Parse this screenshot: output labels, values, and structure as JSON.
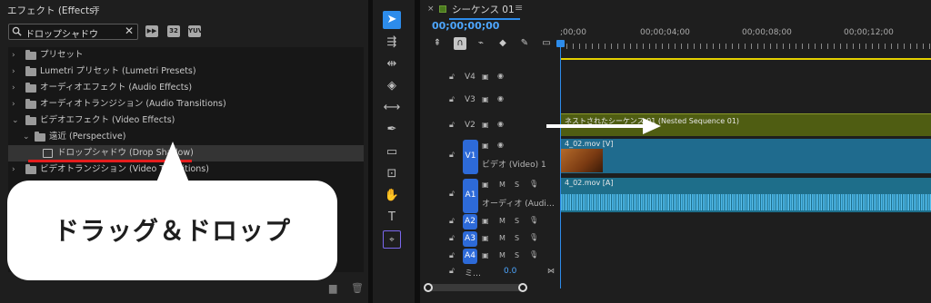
{
  "effects_panel": {
    "title": "エフェクト (Effects)",
    "menu": "≡",
    "search_value": "ドロップシャドウ",
    "clear": "✕",
    "filter_buttons": [
      "▶▶",
      "32",
      "YUV"
    ],
    "tree": [
      {
        "label": "プリセット",
        "arrow": "›",
        "indent": 0,
        "selected": false
      },
      {
        "label": "Lumetri プリセット (Lumetri Presets)",
        "arrow": "›",
        "indent": 0,
        "selected": false
      },
      {
        "label": "オーディオエフェクト (Audio Effects)",
        "arrow": "›",
        "indent": 0,
        "selected": false
      },
      {
        "label": "オーディオトランジション (Audio Transitions)",
        "arrow": "›",
        "indent": 0,
        "selected": false
      },
      {
        "label": "ビデオエフェクト (Video Effects)",
        "arrow": "⌄",
        "indent": 0,
        "selected": false
      },
      {
        "label": "遠近 (Perspective)",
        "arrow": "⌄",
        "indent": 1,
        "selected": false
      },
      {
        "label": "ドロップシャドウ (Drop Shadow)",
        "arrow": "",
        "indent": 2,
        "selected": true
      },
      {
        "label": "ビデオトランジション (Video Transitions)",
        "arrow": "›",
        "indent": 0,
        "selected": false
      }
    ],
    "bottom_icons": [
      "new-folder-icon",
      "trash-icon"
    ]
  },
  "callout": {
    "text": "ドラッグ＆ドロップ"
  },
  "tools": [
    "selection",
    "track-select-forward",
    "ripple-edit",
    "razor",
    "slip",
    "pen",
    "rectangle",
    "hand-move",
    "hand",
    "type",
    "generative-extend"
  ],
  "timeline": {
    "close": "×",
    "title": "シーケンス 01",
    "menu": "≡",
    "timecode": "00;00;00;00",
    "ruler_labels": [
      ";00;00",
      "00;00;04;00",
      "00;00;08;00",
      "00;00;12;00"
    ],
    "tracks": [
      {
        "name": "V4",
        "kind": "video",
        "lock": true
      },
      {
        "name": "V3",
        "kind": "video",
        "lock": true
      },
      {
        "name": "V2",
        "kind": "video",
        "lock": true
      },
      {
        "name": "V1",
        "kind": "video",
        "lock": true,
        "label": "ビデオ (Video) 1"
      },
      {
        "name": "A1",
        "kind": "audio",
        "lock": true,
        "label": "オーディオ (Audi…"
      },
      {
        "name": "A2",
        "kind": "audio",
        "lock": true
      },
      {
        "name": "A3",
        "kind": "audio",
        "lock": true
      },
      {
        "name": "A4",
        "kind": "audio",
        "lock": true
      }
    ],
    "mix": {
      "label": "ミ…",
      "value": "0.0"
    },
    "clips": {
      "nested": "ネストされたシーケンス 01 (Nested Sequence 01)",
      "video": "4_02.mov [V]",
      "audio": "4_02.mov [A]"
    },
    "colors": {
      "accent": "#2d8ceb",
      "nested": "#4f5d12",
      "video_clip": "#1f6b8e",
      "audio_clip": "#1e6e8a",
      "work_area": "#e4d000"
    }
  }
}
